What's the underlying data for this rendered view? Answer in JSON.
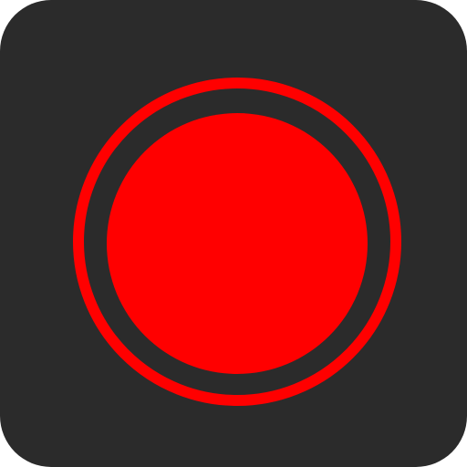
{
  "app_icon": {
    "icon": "record-icon",
    "colors": {
      "background": "#2b2b2b",
      "accent": "#ff0000"
    }
  }
}
